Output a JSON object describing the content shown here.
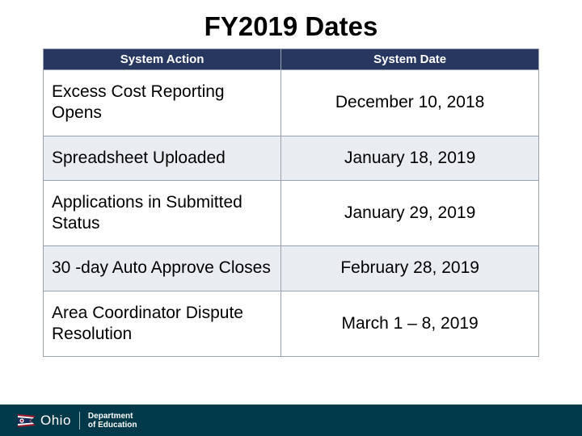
{
  "title": "FY2019 Dates",
  "table": {
    "headers": [
      "System Action",
      "System Date"
    ],
    "rows": [
      {
        "action": "Excess Cost Reporting Opens",
        "date": "December 10, 2018"
      },
      {
        "action": "Spreadsheet Uploaded",
        "date": "January 18, 2019"
      },
      {
        "action": "Applications in Submitted Status",
        "date": "January 29, 2019"
      },
      {
        "action": "30 -day Auto Approve Closes",
        "date": "February 28, 2019"
      },
      {
        "action": "Area Coordinator Dispute Resolution",
        "date": "March 1 – 8, 2019"
      }
    ]
  },
  "footer": {
    "brand": "Ohio",
    "dept_line1": "Department",
    "dept_line2": "of Education"
  },
  "colors": {
    "header_bg": "#283760",
    "row_alt_bg": "#e9edf2",
    "footer_bg": "#003a4a"
  }
}
